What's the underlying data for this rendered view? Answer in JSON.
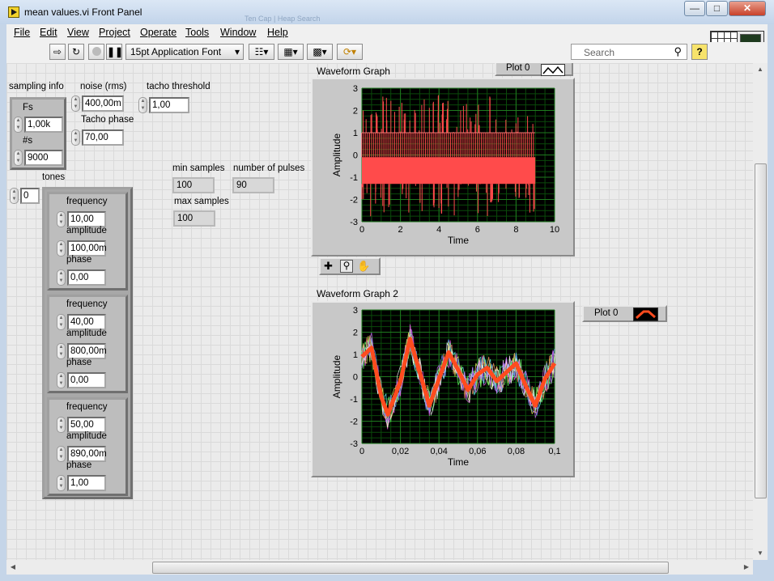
{
  "window": {
    "title": "mean values.vi Front Panel",
    "faded_titlebar_text": "Ten Cap | Heap Search"
  },
  "menu": [
    "File",
    "Edit",
    "View",
    "Project",
    "Operate",
    "Tools",
    "Window",
    "Help"
  ],
  "toolbar": {
    "font": "15pt Application Font",
    "search_placeholder": "Search",
    "help": "?"
  },
  "controls": {
    "sampling_info": "sampling info",
    "fs_label": "Fs",
    "fs_value": "1,00k",
    "ns_label": "#s",
    "ns_value": "9000",
    "noise_label": "noise (rms)",
    "noise_value": "400,00m",
    "tacho_phase_label": "Tacho phase",
    "tacho_phase_value": "70,00",
    "tacho_threshold_label": "tacho threshold",
    "tacho_threshold_value": "1,00",
    "tones_label": "tones",
    "tones_index": "0",
    "tones": [
      {
        "frequency_label": "frequency",
        "frequency": "10,00",
        "amplitude_label": "amplitude",
        "amplitude": "100,00m",
        "phase_label": "phase",
        "phase": "0,00"
      },
      {
        "frequency_label": "frequency",
        "frequency": "40,00",
        "amplitude_label": "amplitude",
        "amplitude": "800,00m",
        "phase_label": "phase",
        "phase": "0,00"
      },
      {
        "frequency_label": "frequency",
        "frequency": "50,00",
        "amplitude_label": "amplitude",
        "amplitude": "890,00m",
        "phase_label": "phase",
        "phase": "1,00"
      }
    ]
  },
  "indicators": {
    "min_samples_label": "min samples",
    "min_samples": "100",
    "max_samples_label": "max samples",
    "max_samples": "100",
    "pulses_label": "number of pulses",
    "pulses": "90"
  },
  "graph1": {
    "title": "Waveform Graph",
    "legend": "Plot 0",
    "xlabel": "Time",
    "ylabel": "Amplitude",
    "xticks": [
      "0",
      "2",
      "4",
      "6",
      "8",
      "10"
    ],
    "yticks": [
      "3",
      "2",
      "1",
      "0",
      "-1",
      "-2",
      "-3"
    ]
  },
  "graph2": {
    "title": "Waveform Graph 2",
    "legend": "Plot 0",
    "xlabel": "Time",
    "ylabel": "Amplitude",
    "xticks": [
      "0",
      "0,02",
      "0,04",
      "0,06",
      "0,08",
      "0,1"
    ],
    "yticks": [
      "3",
      "2",
      "1",
      "0",
      "-1",
      "-2",
      "-3"
    ]
  },
  "chart_data": [
    {
      "type": "line",
      "title": "Waveform Graph",
      "xlabel": "Time",
      "ylabel": "Amplitude",
      "xlim": [
        0,
        10
      ],
      "ylim": [
        -3,
        3
      ],
      "series": [
        {
          "name": "Plot 0",
          "x_range": [
            0,
            9
          ],
          "pulse_count": 90,
          "noise_band": [
            -1.3,
            -0.1
          ],
          "pulse_top": 1,
          "spike_range": [
            -2.8,
            2.7
          ]
        }
      ],
      "grid": true,
      "color": "#ff4b4b"
    },
    {
      "type": "line",
      "title": "Waveform Graph 2",
      "xlabel": "Time",
      "ylabel": "Amplitude",
      "xlim": [
        0,
        0.1
      ],
      "ylim": [
        -3,
        3
      ],
      "series": [
        {
          "name": "Plot 0",
          "x": [
            0,
            0.005,
            0.01,
            0.0135,
            0.02,
            0.025,
            0.03,
            0.035,
            0.04,
            0.045,
            0.05,
            0.055,
            0.06,
            0.065,
            0.07,
            0.075,
            0.08,
            0.085,
            0.09,
            0.095,
            0.1
          ],
          "y": [
            0.9,
            1.3,
            -0.9,
            -1.7,
            -0.2,
            1.7,
            0.2,
            -1.3,
            -0.1,
            1.1,
            0.3,
            -0.6,
            0.1,
            0.4,
            -0.2,
            0.2,
            0.6,
            -0.4,
            -1.3,
            -0.1,
            0.6
          ]
        }
      ],
      "grid": true,
      "color": "#ff4b1e"
    }
  ]
}
